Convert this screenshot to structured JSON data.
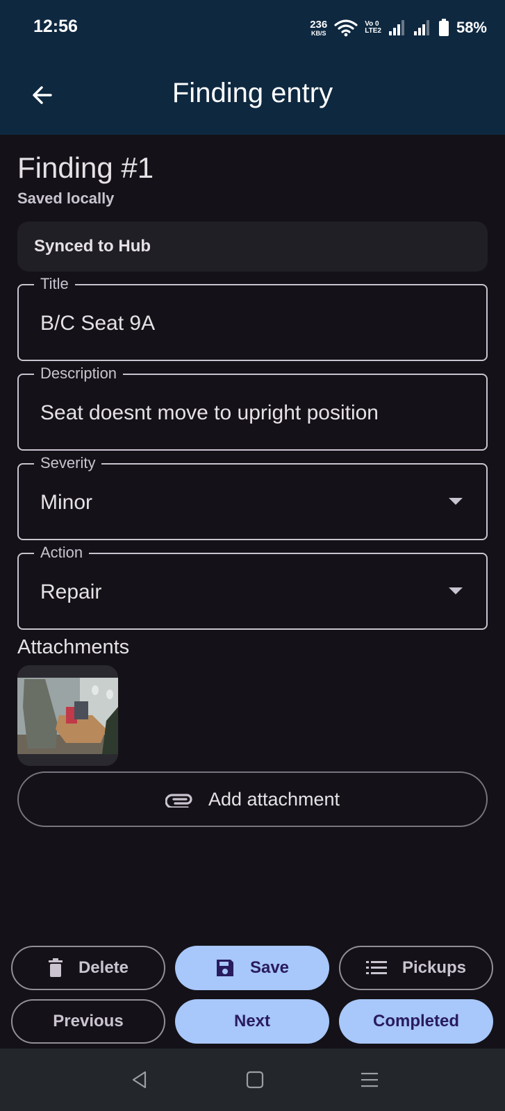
{
  "status_bar": {
    "time": "12:56",
    "net_speed_value": "236",
    "net_speed_unit": "KB/S",
    "volte_top": "Vo 0",
    "volte_bottom": "LTE2",
    "battery": "58%"
  },
  "app_bar": {
    "title": "Finding entry",
    "back_icon": "arrow-back-icon"
  },
  "finding": {
    "title": "Finding #1",
    "subtitle": "Saved locally"
  },
  "sync_card": {
    "label": "Synced to Hub"
  },
  "fields": {
    "title": {
      "label": "Title",
      "value": "B/C Seat 9A"
    },
    "description": {
      "label": "Description",
      "value": "Seat doesnt move to upright position"
    },
    "severity": {
      "label": "Severity",
      "value": "Minor"
    },
    "action": {
      "label": "Action",
      "value": "Repair"
    }
  },
  "attachments": {
    "heading": "Attachments",
    "add_label": "Add attachment",
    "add_icon": "paperclip-icon"
  },
  "actions": {
    "delete": "Delete",
    "save": "Save",
    "pickups": "Pickups",
    "previous": "Previous",
    "next": "Next",
    "completed": "Completed"
  },
  "colors": {
    "background": "#141218",
    "app_bar": "#0E2840",
    "primary_container": "#A8C7FA",
    "on_primary_container": "#281B5E",
    "outline": "#CAC4D0",
    "surface_container": "#211F26",
    "nav_bar": "#23272B"
  }
}
